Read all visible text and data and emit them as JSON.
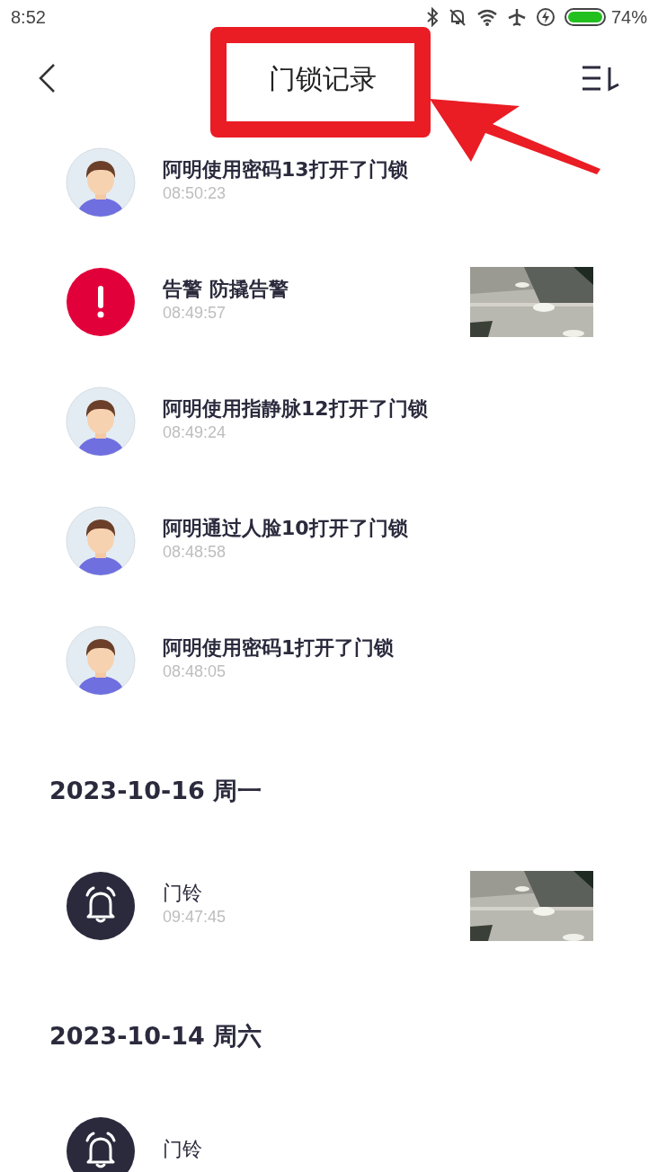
{
  "status_bar": {
    "time": "8:52",
    "battery": "74%"
  },
  "header": {
    "title": "门锁记录"
  },
  "sections": [
    {
      "items": [
        {
          "kind": "user",
          "title": "阿明使用密码13打开了门锁",
          "time": "08:50:23"
        },
        {
          "kind": "alert",
          "title": "告警 防撬告警",
          "time": "08:49:57"
        },
        {
          "kind": "user",
          "title": "阿明使用指静脉12打开了门锁",
          "time": "08:49:24"
        },
        {
          "kind": "user",
          "title": "阿明通过人脸10打开了门锁",
          "time": "08:48:58"
        },
        {
          "kind": "user",
          "title": "阿明使用密码1打开了门锁",
          "time": "08:48:05"
        }
      ]
    },
    {
      "date": "2023-10-16 周一",
      "items": [
        {
          "kind": "doorbell",
          "title": "门铃",
          "time": "09:47:45"
        }
      ]
    },
    {
      "date": "2023-10-14 周六",
      "items": [
        {
          "kind": "doorbell",
          "title": "门铃"
        }
      ]
    }
  ]
}
